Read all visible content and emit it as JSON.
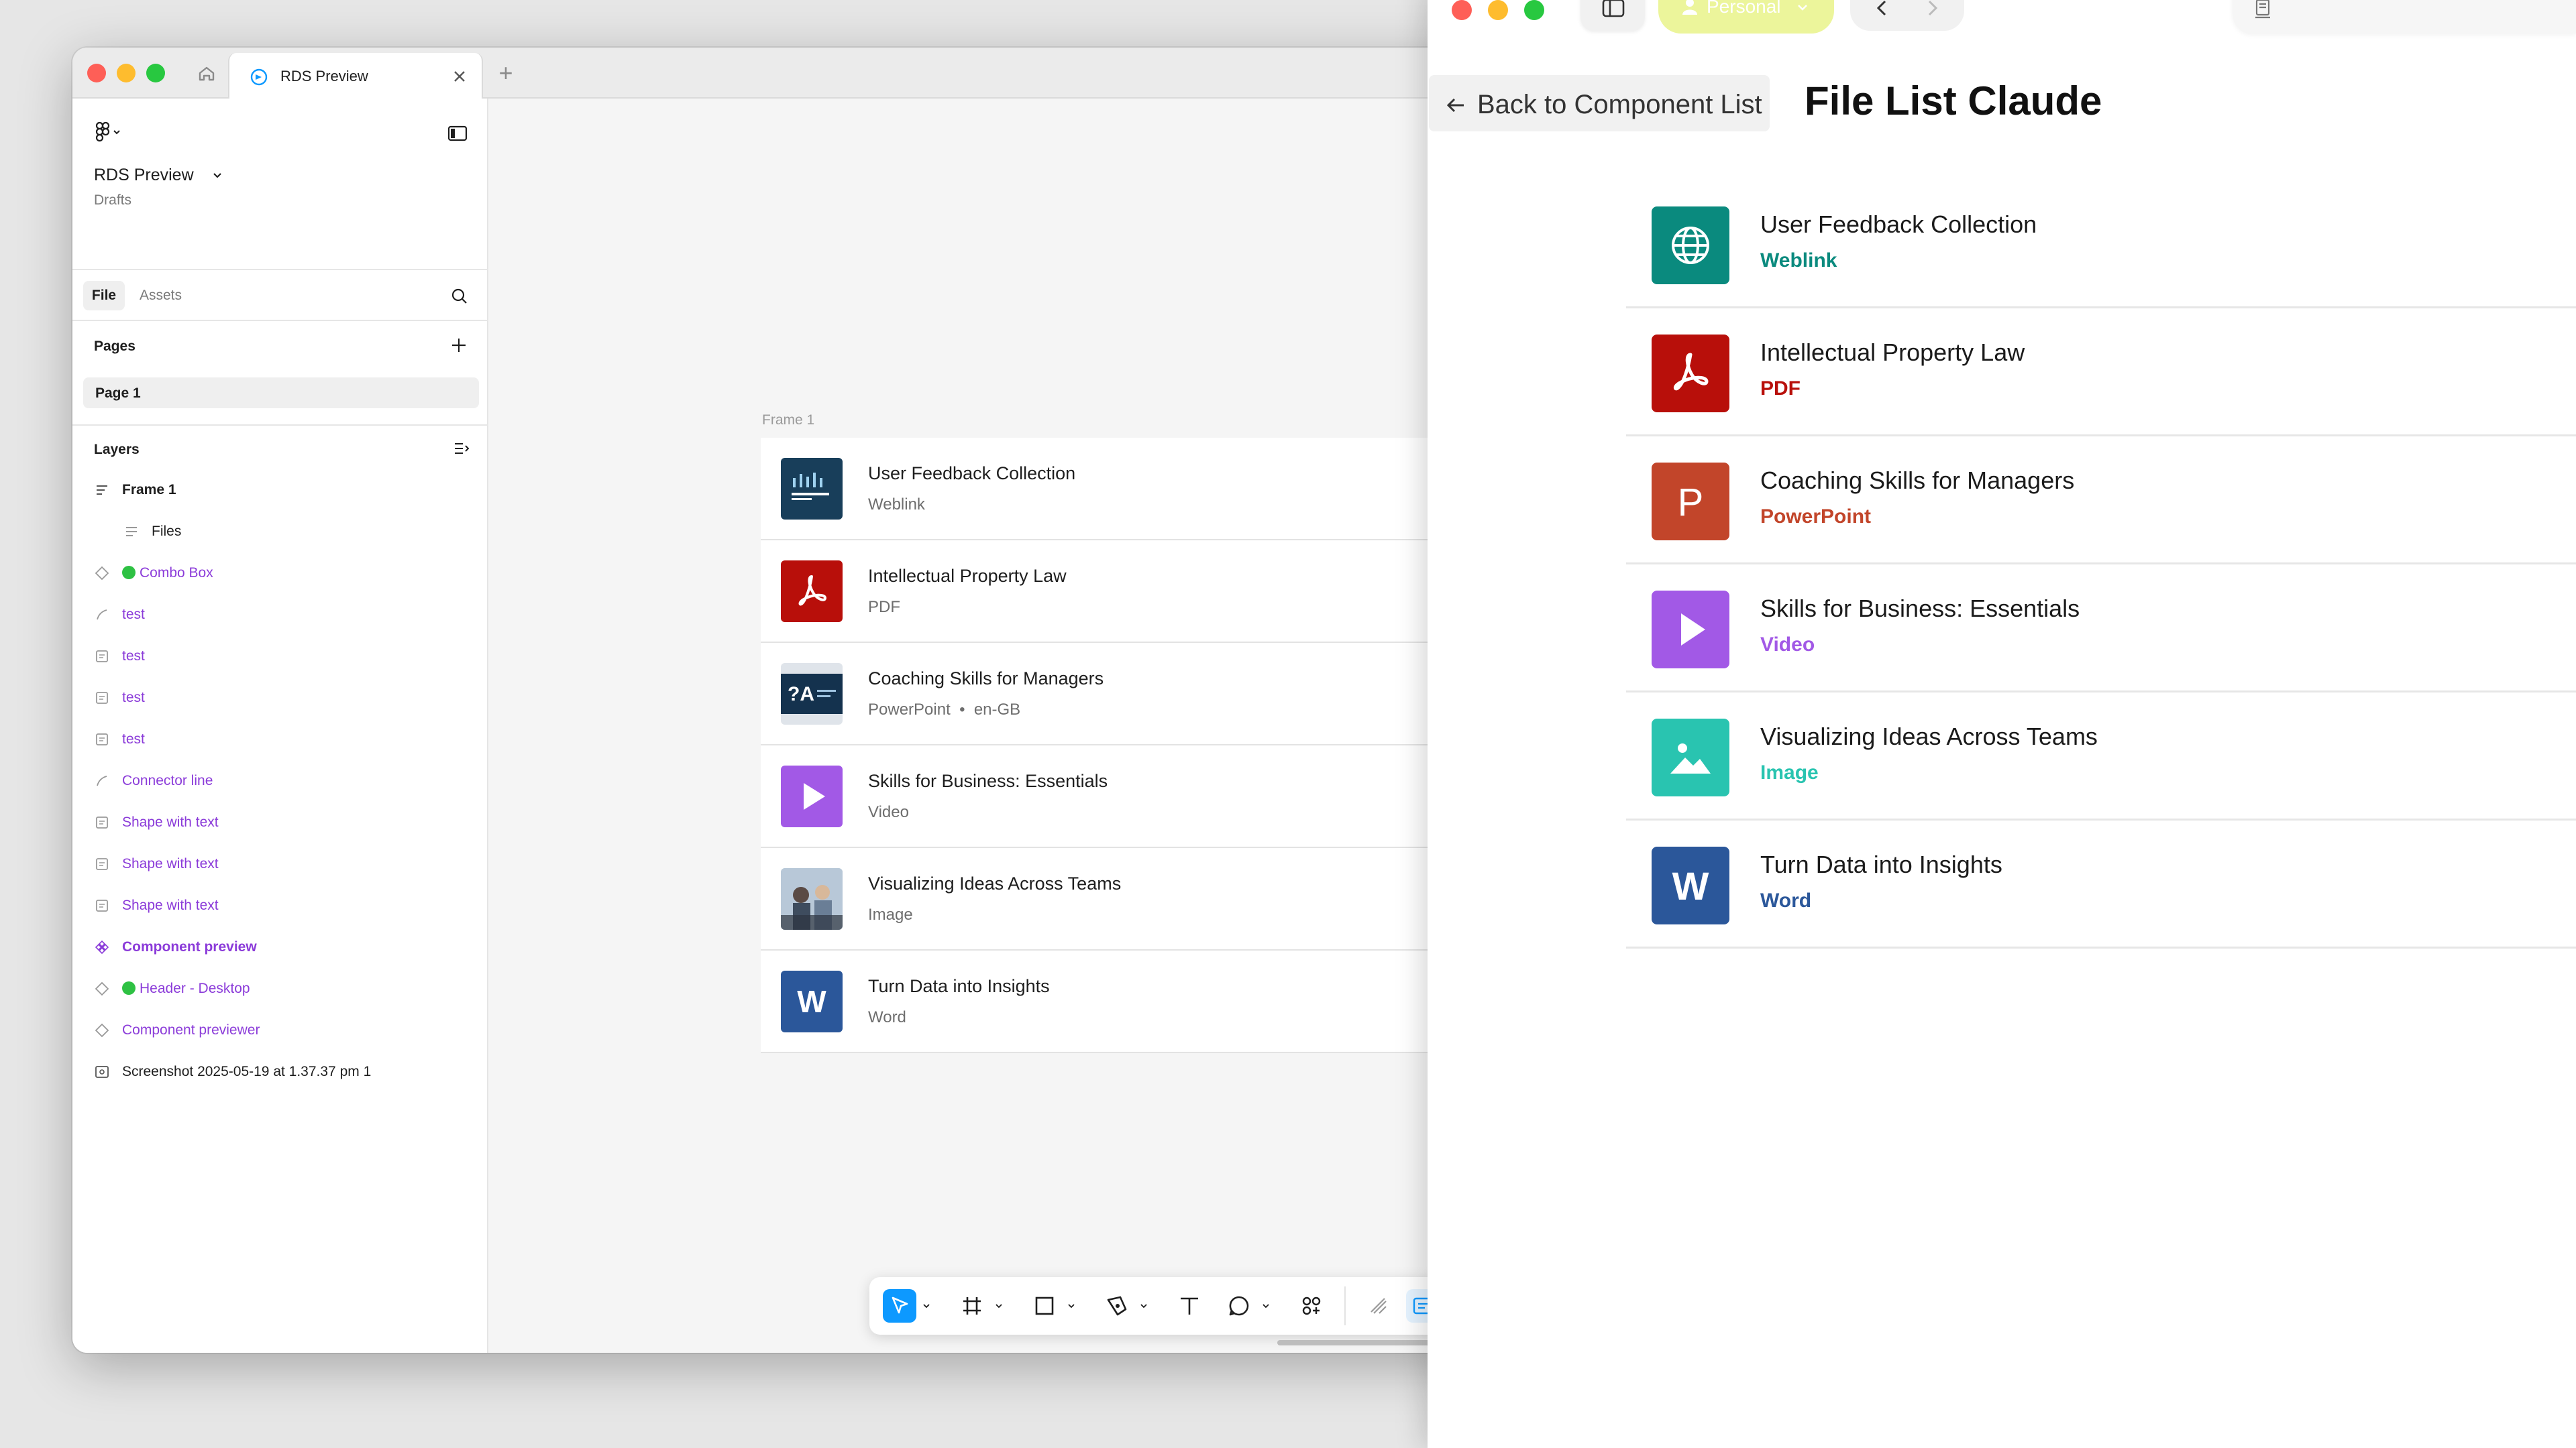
{
  "figma": {
    "tab_title": "RDS Preview",
    "project_name": "RDS Preview",
    "project_location": "Drafts",
    "panel_tabs": {
      "file": "File",
      "assets": "Assets"
    },
    "pages_heading": "Pages",
    "pages": [
      "Page 1"
    ],
    "layers_heading": "Layers",
    "layers": [
      {
        "label": "Frame 1",
        "style": "bold",
        "indent": 0,
        "icon": "frame-icon"
      },
      {
        "label": "Files",
        "style": "normal",
        "indent": 1,
        "icon": "autolayout-icon"
      },
      {
        "label": "Combo Box",
        "style": "purple",
        "indent": 0,
        "icon": "instance-icon",
        "dot": true
      },
      {
        "label": "test",
        "style": "purple",
        "indent": 0,
        "icon": "line-icon"
      },
      {
        "label": "test",
        "style": "purple",
        "indent": 0,
        "icon": "shape-text-icon"
      },
      {
        "label": "test",
        "style": "purple",
        "indent": 0,
        "icon": "shape-text-icon"
      },
      {
        "label": "test",
        "style": "purple",
        "indent": 0,
        "icon": "shape-text-icon"
      },
      {
        "label": "Connector line",
        "style": "purple",
        "indent": 0,
        "icon": "line-icon"
      },
      {
        "label": "Shape with text",
        "style": "purple",
        "indent": 0,
        "icon": "shape-text-icon"
      },
      {
        "label": "Shape with text",
        "style": "purple",
        "indent": 0,
        "icon": "shape-text-icon"
      },
      {
        "label": "Shape with text",
        "style": "purple",
        "indent": 0,
        "icon": "shape-text-icon"
      },
      {
        "label": "Component preview",
        "style": "purple-bold",
        "indent": 0,
        "icon": "component-icon"
      },
      {
        "label": "Header - Desktop",
        "style": "purple",
        "indent": 0,
        "icon": "instance-icon",
        "dot": true
      },
      {
        "label": "Component previewer",
        "style": "purple",
        "indent": 0,
        "icon": "instance-icon"
      },
      {
        "label": "Screenshot 2025-05-19 at 1.37.37 pm 1",
        "style": "normal",
        "indent": 0,
        "icon": "image-icon"
      }
    ],
    "frame_label": "Frame 1",
    "files": [
      {
        "title": "User Feedback Collection",
        "type": "Weblink",
        "lang": ""
      },
      {
        "title": "Intellectual Property Law",
        "type": "PDF",
        "lang": ""
      },
      {
        "title": "Coaching Skills for Managers",
        "type": "PowerPoint",
        "lang": "en-GB"
      },
      {
        "title": "Skills for Business: Essentials",
        "type": "Video",
        "lang": ""
      },
      {
        "title": "Visualizing Ideas Across Teams",
        "type": "Image",
        "lang": ""
      },
      {
        "title": "Turn Data into Insights",
        "type": "Word",
        "lang": ""
      }
    ],
    "colors": {
      "accent": "#0d99ff",
      "component_purple": "#8b3bd9",
      "dot_green": "#2ec143"
    }
  },
  "browser": {
    "profile_label": "Personal",
    "back_label": "Back to Component List",
    "page_title": "File List Claude",
    "files": [
      {
        "title": "User Feedback Collection",
        "type": "Weblink",
        "color": "#0a8a7e",
        "letter": "",
        "icon": "globe-icon"
      },
      {
        "title": "Intellectual Property Law",
        "type": "PDF",
        "color": "#b80f0a",
        "letter": "",
        "icon": "acrobat-icon"
      },
      {
        "title": "Coaching Skills for Managers",
        "type": "PowerPoint",
        "color": "#c2452a",
        "letter": "P",
        "icon": "powerpoint-icon"
      },
      {
        "title": "Skills for Business: Essentials",
        "type": "Video",
        "color": "#a259e6",
        "letter": "",
        "icon": "play-icon"
      },
      {
        "title": "Visualizing Ideas Across Teams",
        "type": "Image",
        "color": "#29c4b0",
        "letter": "",
        "icon": "image-icon"
      },
      {
        "title": "Turn Data into Insights",
        "type": "Word",
        "color": "#2b579a",
        "letter": "W",
        "icon": "word-icon"
      }
    ]
  }
}
